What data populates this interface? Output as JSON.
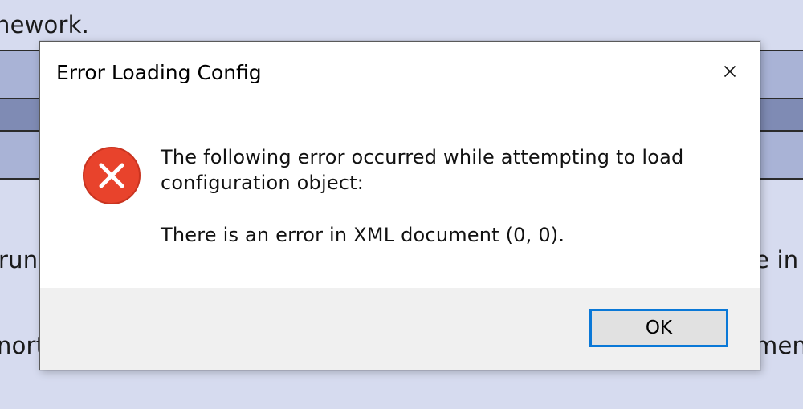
{
  "background": {
    "top_text": "nework.",
    "row1_left": "run",
    "row1_right": "e in",
    "row2_left": "nort",
    "row2_right": "men"
  },
  "dialog": {
    "title": "Error Loading Config",
    "close_icon": "close-icon",
    "error_icon": "error-icon",
    "message_line1": "The following error occurred while attempting to load",
    "message_line2": "configuration object:",
    "detail": "There is an error in XML document (0, 0).",
    "ok_label": "OK"
  },
  "colors": {
    "error_red": "#e8432c",
    "accent_blue": "#0a78d7",
    "footer_bg": "#f0f0f0",
    "page_bg": "#d6dbef"
  }
}
